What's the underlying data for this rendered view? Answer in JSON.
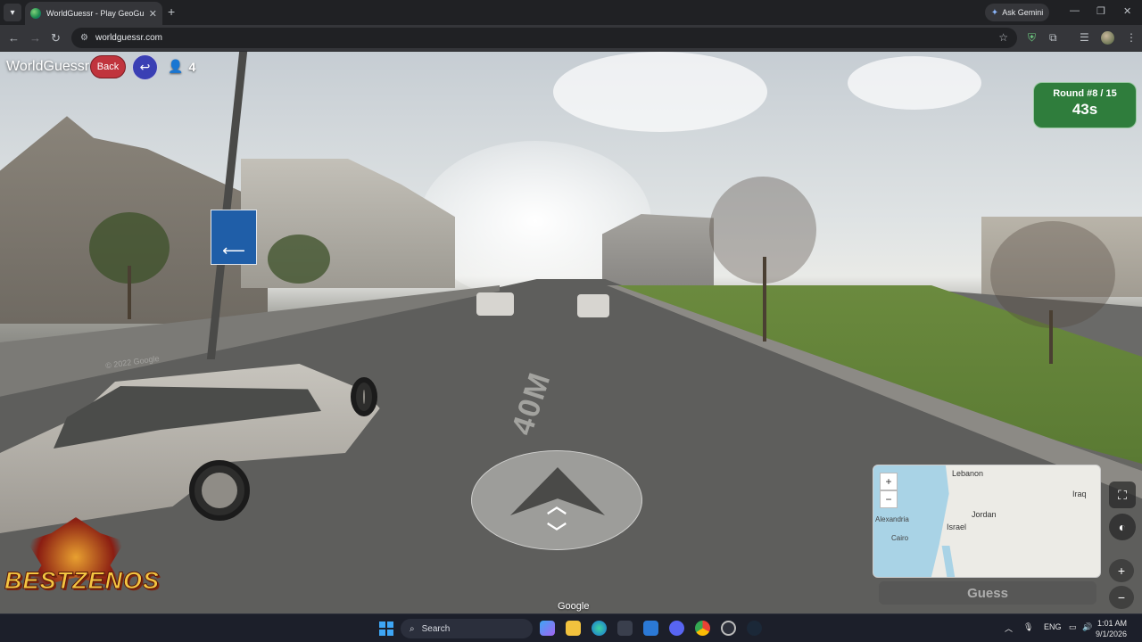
{
  "browser": {
    "tab_title": "WorldGuessr - Play GeoGuessr F",
    "url": "worldguessr.com",
    "ask_gemini": "Ask Gemini"
  },
  "game": {
    "brand": "WorldGuessr",
    "back_label": "Back",
    "player_count": "4",
    "round_label": "Round #8 / 15",
    "timer": "43s",
    "guess_label": "Guess",
    "google_watermark": "Google",
    "road_marking": "40M",
    "cover_text": "© 2022 Google"
  },
  "map": {
    "labels": [
      "Lebanon",
      "Iraq",
      "Jordan",
      "Israel",
      "Alexandria",
      "Cairo"
    ],
    "zoom_in": "+",
    "zoom_out": "−"
  },
  "overlay_logo": "BESTZENOS",
  "taskbar": {
    "search_placeholder": "Search",
    "language": "ENG",
    "time": "1:01 AM",
    "date": "9/1/2026"
  },
  "colors": {
    "round_box": "#2f7d3c",
    "back_button": "#c0343d",
    "undo_button": "#3a3fb4"
  }
}
